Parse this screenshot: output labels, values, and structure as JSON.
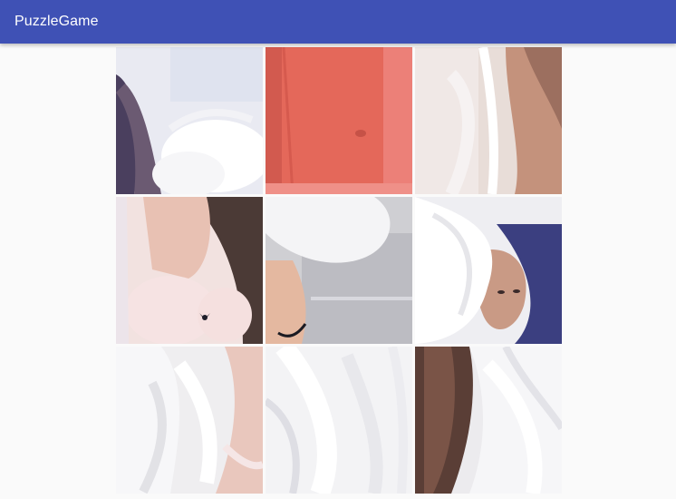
{
  "app_bar": {
    "title": "PuzzleGame",
    "color": "#3f51b5"
  },
  "board": {
    "rows": 3,
    "columns": 3,
    "tiles": [
      {
        "index": 0,
        "content": "photo-piece",
        "dominant_color": "#e9eaf2"
      },
      {
        "index": 1,
        "content": "photo-piece",
        "dominant_color": "#e4685a"
      },
      {
        "index": 2,
        "content": "photo-piece",
        "dominant_color": "#e8ddd8"
      },
      {
        "index": 3,
        "content": "photo-piece",
        "dominant_color": "#f2e2e0"
      },
      {
        "index": 4,
        "content": "photo-piece",
        "dominant_color": "#cfcfd3"
      },
      {
        "index": 5,
        "content": "photo-piece",
        "dominant_color": "#eeeef2"
      },
      {
        "index": 6,
        "content": "photo-piece",
        "dominant_color": "#efeef0"
      },
      {
        "index": 7,
        "content": "photo-piece",
        "dominant_color": "#f3f3f5"
      },
      {
        "index": 8,
        "content": "photo-piece",
        "dominant_color": "#ecebee"
      }
    ]
  }
}
